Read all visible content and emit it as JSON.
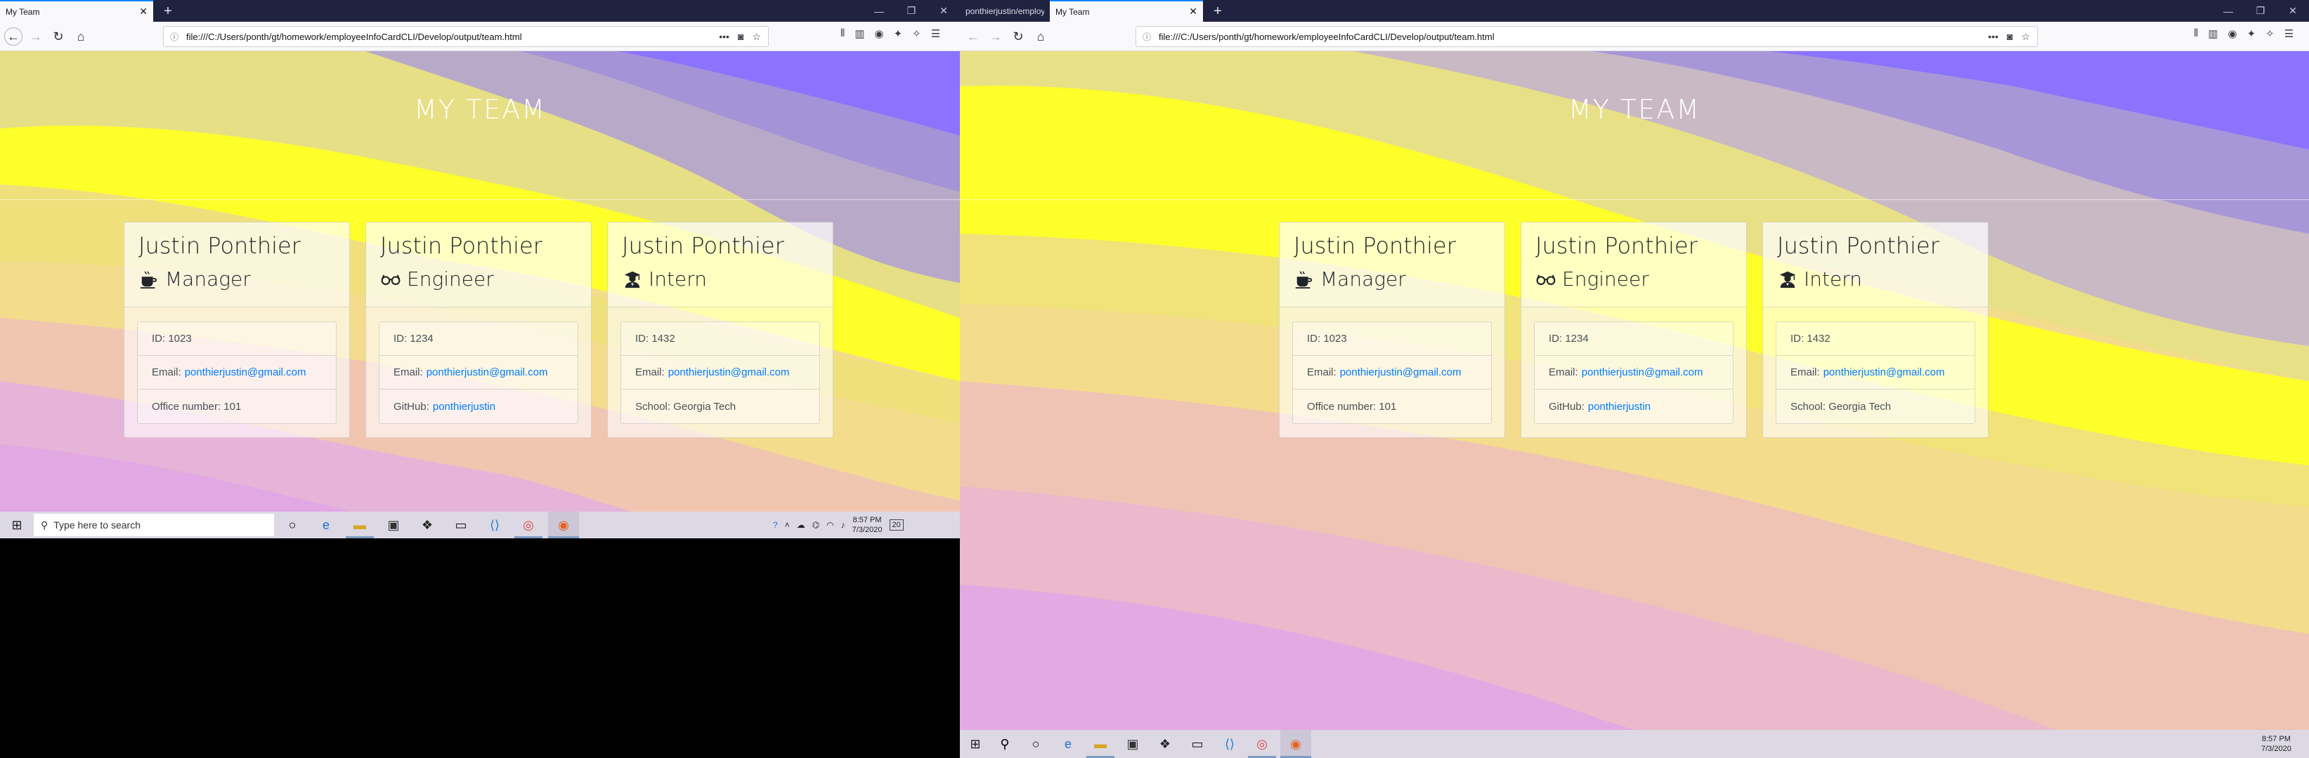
{
  "left": {
    "tabs": [
      {
        "title": "My Team"
      }
    ],
    "url": "file:///C:/Users/ponth/gt/homework/employeeInfoCardCLI/Develop/output/team.html",
    "taskbar": {
      "search_placeholder": "Type here to search",
      "time": "8:57 PM",
      "date": "7/3/2020",
      "notification_count": "20"
    }
  },
  "right": {
    "tabs": [
      {
        "title": "ponthierjustin/employeeInfoC"
      },
      {
        "title": "My Team"
      }
    ],
    "url": "file:///C:/Users/ponth/gt/homework/employeeInfoCardCLI/Develop/output/team.html",
    "taskbar": {
      "time": "8:57 PM",
      "date": "7/3/2020"
    }
  },
  "page": {
    "heading": "MY TEAM",
    "cards": [
      {
        "name": "Justin Ponthier",
        "role": "Manager",
        "icon": "coffee-icon",
        "id_label": "ID: 1023",
        "email_label": "Email:",
        "email": "ponthierjustin@gmail.com",
        "extra_label": "Office number: 101",
        "extra_link": ""
      },
      {
        "name": "Justin Ponthier",
        "role": "Engineer",
        "icon": "glasses-icon",
        "id_label": "ID: 1234",
        "email_label": "Email:",
        "email": "ponthierjustin@gmail.com",
        "extra_label": "GitHub:",
        "extra_link": "ponthierjustin"
      },
      {
        "name": "Justin Ponthier",
        "role": "Intern",
        "icon": "graduate-icon",
        "id_label": "ID: 1432",
        "email_label": "Email:",
        "email": "ponthierjustin@gmail.com",
        "extra_label": "School: Georgia Tech",
        "extra_link": ""
      }
    ]
  },
  "colors": {
    "link": "#007bff",
    "tabbar": "#202340",
    "accent_tab": "#0a84ff",
    "taskbar": "#dcd9e4"
  }
}
